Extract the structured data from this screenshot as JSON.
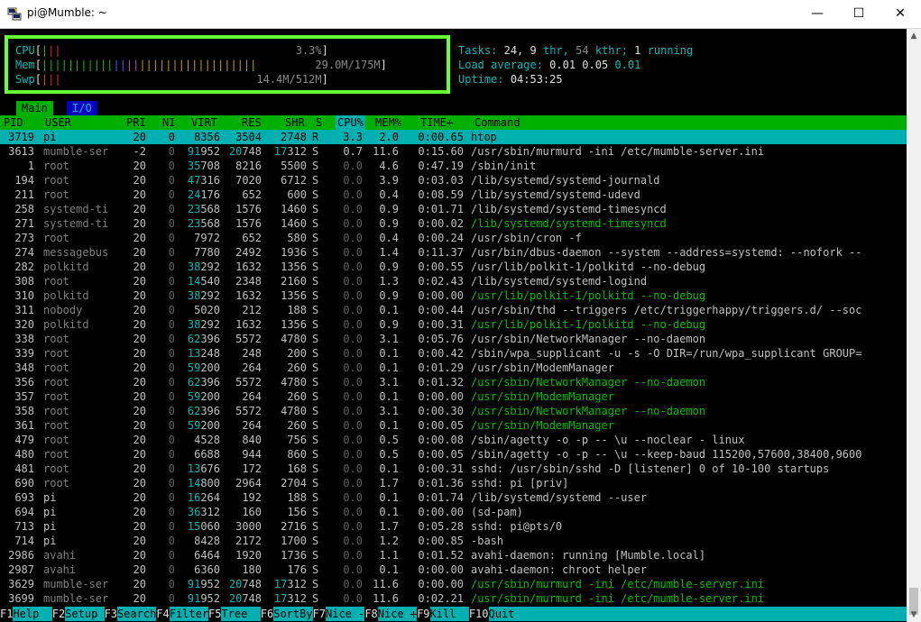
{
  "window": {
    "title": "pi@Mumble: ~",
    "minimize": "—",
    "maximize": "☐",
    "close": "✕"
  },
  "meters": {
    "cpu_label": "CPU",
    "cpu_value": "3.3%",
    "mem_label": "Mem",
    "mem_value": "29.0M/175M",
    "swp_label": "Swp",
    "swp_value": "14.4M/512M"
  },
  "summary": {
    "tasks_label": "Tasks:",
    "tasks": "24,",
    "thr": "9",
    "thr_label": "thr,",
    "kthr": "54",
    "kthr_label": "kthr;",
    "running": "1",
    "running_label": "running",
    "load_label": "Load average:",
    "load1": "0.01",
    "load5": "0.05",
    "load15": "0.01",
    "uptime_label": "Uptime:",
    "uptime": "04:53:25"
  },
  "tabs": {
    "main": "Main",
    "io": "I/O"
  },
  "columns": [
    "PID",
    "USER",
    "PRI",
    "NI",
    "VIRT",
    "RES",
    "SHR",
    "S",
    "CPU%",
    "MEM%",
    "TIME+",
    "Command"
  ],
  "rows": [
    {
      "pid": "3719",
      "user": "pi",
      "pri": "20",
      "ni": "0",
      "virt": "8356",
      "res": "3504",
      "shr": "2748",
      "s": "R",
      "cpu": "3.3",
      "mem": "2.0",
      "time": "0:00.65",
      "cmd": "htop",
      "sel": true
    },
    {
      "pid": "3613",
      "user": "mumble-ser",
      "pri": "-2",
      "ni": "0",
      "virt": "91952",
      "res": "20748",
      "shr": "17312",
      "s": "S",
      "cpu": "0.7",
      "mem": "11.6",
      "time": "0:15.60",
      "cmd": "/usr/sbin/murmurd -ini /etc/mumble-server.ini"
    },
    {
      "pid": "1",
      "user": "root",
      "pri": "20",
      "ni": "0",
      "virt": "35708",
      "res": "8216",
      "shr": "5500",
      "s": "S",
      "cpu": "0.0",
      "mem": "4.6",
      "time": "0:47.19",
      "cmd": "/sbin/init"
    },
    {
      "pid": "194",
      "user": "root",
      "pri": "20",
      "ni": "0",
      "virt": "47316",
      "res": "7020",
      "shr": "6712",
      "s": "S",
      "cpu": "0.0",
      "mem": "3.9",
      "time": "0:03.03",
      "cmd": "/lib/systemd/systemd-journald"
    },
    {
      "pid": "211",
      "user": "root",
      "pri": "20",
      "ni": "0",
      "virt": "24176",
      "res": "652",
      "shr": "600",
      "s": "S",
      "cpu": "0.0",
      "mem": "0.4",
      "time": "0:08.59",
      "cmd": "/lib/systemd/systemd-udevd"
    },
    {
      "pid": "258",
      "user": "systemd-ti",
      "pri": "20",
      "ni": "0",
      "virt": "23568",
      "res": "1576",
      "shr": "1460",
      "s": "S",
      "cpu": "0.0",
      "mem": "0.9",
      "time": "0:01.71",
      "cmd": "/lib/systemd/systemd-timesyncd"
    },
    {
      "pid": "271",
      "user": "systemd-ti",
      "pri": "20",
      "ni": "0",
      "virt": "23568",
      "res": "1576",
      "shr": "1460",
      "s": "S",
      "cpu": "0.0",
      "mem": "0.9",
      "time": "0:00.02",
      "cmd": "/lib/systemd/systemd-timesyncd",
      "thread": true
    },
    {
      "pid": "273",
      "user": "root",
      "pri": "20",
      "ni": "0",
      "virt": "7972",
      "res": "652",
      "shr": "580",
      "s": "S",
      "cpu": "0.0",
      "mem": "0.4",
      "time": "0:00.24",
      "cmd": "/usr/sbin/cron -f"
    },
    {
      "pid": "274",
      "user": "messagebus",
      "pri": "20",
      "ni": "0",
      "virt": "7780",
      "res": "2492",
      "shr": "1936",
      "s": "S",
      "cpu": "0.0",
      "mem": "1.4",
      "time": "0:11.37",
      "cmd": "/usr/bin/dbus-daemon --system --address=systemd: --nofork --"
    },
    {
      "pid": "282",
      "user": "polkitd",
      "pri": "20",
      "ni": "0",
      "virt": "38292",
      "res": "1632",
      "shr": "1356",
      "s": "S",
      "cpu": "0.0",
      "mem": "0.9",
      "time": "0:00.55",
      "cmd": "/usr/lib/polkit-1/polkitd --no-debug"
    },
    {
      "pid": "308",
      "user": "root",
      "pri": "20",
      "ni": "0",
      "virt": "14540",
      "res": "2348",
      "shr": "2160",
      "s": "S",
      "cpu": "0.0",
      "mem": "1.3",
      "time": "0:02.43",
      "cmd": "/lib/systemd/systemd-logind"
    },
    {
      "pid": "310",
      "user": "polkitd",
      "pri": "20",
      "ni": "0",
      "virt": "38292",
      "res": "1632",
      "shr": "1356",
      "s": "S",
      "cpu": "0.0",
      "mem": "0.9",
      "time": "0:00.00",
      "cmd": "/usr/lib/polkit-1/polkitd --no-debug",
      "thread": true
    },
    {
      "pid": "311",
      "user": "nobody",
      "pri": "20",
      "ni": "0",
      "virt": "5020",
      "res": "212",
      "shr": "188",
      "s": "S",
      "cpu": "0.0",
      "mem": "0.1",
      "time": "0:00.44",
      "cmd": "/usr/sbin/thd --triggers /etc/triggerhappy/triggers.d/ --soc"
    },
    {
      "pid": "320",
      "user": "polkitd",
      "pri": "20",
      "ni": "0",
      "virt": "38292",
      "res": "1632",
      "shr": "1356",
      "s": "S",
      "cpu": "0.0",
      "mem": "0.9",
      "time": "0:00.31",
      "cmd": "/usr/lib/polkit-1/polkitd --no-debug",
      "thread": true
    },
    {
      "pid": "338",
      "user": "root",
      "pri": "20",
      "ni": "0",
      "virt": "62396",
      "res": "5572",
      "shr": "4780",
      "s": "S",
      "cpu": "0.0",
      "mem": "3.1",
      "time": "0:05.76",
      "cmd": "/usr/sbin/NetworkManager --no-daemon"
    },
    {
      "pid": "339",
      "user": "root",
      "pri": "20",
      "ni": "0",
      "virt": "13248",
      "res": "248",
      "shr": "200",
      "s": "S",
      "cpu": "0.0",
      "mem": "0.1",
      "time": "0:00.42",
      "cmd": "/sbin/wpa_supplicant -u -s -O DIR=/run/wpa_supplicant GROUP="
    },
    {
      "pid": "348",
      "user": "root",
      "pri": "20",
      "ni": "0",
      "virt": "59200",
      "res": "264",
      "shr": "260",
      "s": "S",
      "cpu": "0.0",
      "mem": "0.1",
      "time": "0:01.29",
      "cmd": "/usr/sbin/ModemManager"
    },
    {
      "pid": "356",
      "user": "root",
      "pri": "20",
      "ni": "0",
      "virt": "62396",
      "res": "5572",
      "shr": "4780",
      "s": "S",
      "cpu": "0.0",
      "mem": "3.1",
      "time": "0:01.32",
      "cmd": "/usr/sbin/NetworkManager --no-daemon",
      "thread": true
    },
    {
      "pid": "357",
      "user": "root",
      "pri": "20",
      "ni": "0",
      "virt": "59200",
      "res": "264",
      "shr": "260",
      "s": "S",
      "cpu": "0.0",
      "mem": "0.1",
      "time": "0:00.00",
      "cmd": "/usr/sbin/ModemManager",
      "thread": true
    },
    {
      "pid": "358",
      "user": "root",
      "pri": "20",
      "ni": "0",
      "virt": "62396",
      "res": "5572",
      "shr": "4780",
      "s": "S",
      "cpu": "0.0",
      "mem": "3.1",
      "time": "0:00.30",
      "cmd": "/usr/sbin/NetworkManager --no-daemon",
      "thread": true
    },
    {
      "pid": "361",
      "user": "root",
      "pri": "20",
      "ni": "0",
      "virt": "59200",
      "res": "264",
      "shr": "260",
      "s": "S",
      "cpu": "0.0",
      "mem": "0.1",
      "time": "0:00.05",
      "cmd": "/usr/sbin/ModemManager",
      "thread": true
    },
    {
      "pid": "479",
      "user": "root",
      "pri": "20",
      "ni": "0",
      "virt": "4528",
      "res": "840",
      "shr": "756",
      "s": "S",
      "cpu": "0.0",
      "mem": "0.5",
      "time": "0:00.08",
      "cmd": "/sbin/agetty -o -p -- \\u --noclear - linux"
    },
    {
      "pid": "480",
      "user": "root",
      "pri": "20",
      "ni": "0",
      "virt": "6688",
      "res": "944",
      "shr": "860",
      "s": "S",
      "cpu": "0.0",
      "mem": "0.5",
      "time": "0:00.05",
      "cmd": "/sbin/agetty -o -p -- \\u --keep-baud 115200,57600,38400,9600"
    },
    {
      "pid": "481",
      "user": "root",
      "pri": "20",
      "ni": "0",
      "virt": "13676",
      "res": "172",
      "shr": "168",
      "s": "S",
      "cpu": "0.0",
      "mem": "0.1",
      "time": "0:00.31",
      "cmd": "sshd: /usr/sbin/sshd -D [listener] 0 of 10-100 startups"
    },
    {
      "pid": "690",
      "user": "root",
      "pri": "20",
      "ni": "0",
      "virt": "14800",
      "res": "2964",
      "shr": "2704",
      "s": "S",
      "cpu": "0.0",
      "mem": "1.7",
      "time": "0:01.36",
      "cmd": "sshd: pi [priv]"
    },
    {
      "pid": "693",
      "user": "pi",
      "pri": "20",
      "ni": "0",
      "virt": "16264",
      "res": "192",
      "shr": "188",
      "s": "S",
      "cpu": "0.0",
      "mem": "0.1",
      "time": "0:01.74",
      "cmd": "/lib/systemd/systemd --user"
    },
    {
      "pid": "694",
      "user": "pi",
      "pri": "20",
      "ni": "0",
      "virt": "36312",
      "res": "160",
      "shr": "156",
      "s": "S",
      "cpu": "0.0",
      "mem": "0.1",
      "time": "0:00.00",
      "cmd": "(sd-pam)"
    },
    {
      "pid": "713",
      "user": "pi",
      "pri": "20",
      "ni": "0",
      "virt": "15060",
      "res": "3000",
      "shr": "2716",
      "s": "S",
      "cpu": "0.0",
      "mem": "1.7",
      "time": "0:05.28",
      "cmd": "sshd: pi@pts/0"
    },
    {
      "pid": "714",
      "user": "pi",
      "pri": "20",
      "ni": "0",
      "virt": "8428",
      "res": "2172",
      "shr": "1700",
      "s": "S",
      "cpu": "0.0",
      "mem": "1.2",
      "time": "0:00.85",
      "cmd": "-bash"
    },
    {
      "pid": "2986",
      "user": "avahi",
      "pri": "20",
      "ni": "0",
      "virt": "6464",
      "res": "1920",
      "shr": "1736",
      "s": "S",
      "cpu": "0.0",
      "mem": "1.1",
      "time": "0:01.52",
      "cmd": "avahi-daemon: running [Mumble.local]"
    },
    {
      "pid": "2987",
      "user": "avahi",
      "pri": "20",
      "ni": "0",
      "virt": "6360",
      "res": "180",
      "shr": "176",
      "s": "S",
      "cpu": "0.0",
      "mem": "0.1",
      "time": "0:00.00",
      "cmd": "avahi-daemon: chroot helper"
    },
    {
      "pid": "3629",
      "user": "mumble-ser",
      "pri": "20",
      "ni": "0",
      "virt": "91952",
      "res": "20748",
      "shr": "17312",
      "s": "S",
      "cpu": "0.0",
      "mem": "11.6",
      "time": "0:00.00",
      "cmd": "/usr/sbin/murmurd -ini /etc/mumble-server.ini",
      "thread": true
    },
    {
      "pid": "3699",
      "user": "mumble-ser",
      "pri": "20",
      "ni": "0",
      "virt": "91952",
      "res": "20748",
      "shr": "17312",
      "s": "S",
      "cpu": "0.0",
      "mem": "11.6",
      "time": "0:02.21",
      "cmd": "/usr/sbin/murmurd -ini /etc/mumble-server.ini",
      "thread": true
    }
  ],
  "footer": [
    {
      "key": "F1",
      "label": "Help  "
    },
    {
      "key": "F2",
      "label": "Setup "
    },
    {
      "key": "F3",
      "label": "Search"
    },
    {
      "key": "F4",
      "label": "Filter"
    },
    {
      "key": "F5",
      "label": "Tree  "
    },
    {
      "key": "F6",
      "label": "SortBy"
    },
    {
      "key": "F7",
      "label": "Nice -"
    },
    {
      "key": "F8",
      "label": "Nice +"
    },
    {
      "key": "F9",
      "label": "Kill  "
    },
    {
      "key": "F10",
      "label": "Quit"
    }
  ],
  "colors": {
    "accent_green": "#00b000",
    "highlight_cyan": "#00b0b0",
    "annotation_green": "#66ff33"
  }
}
